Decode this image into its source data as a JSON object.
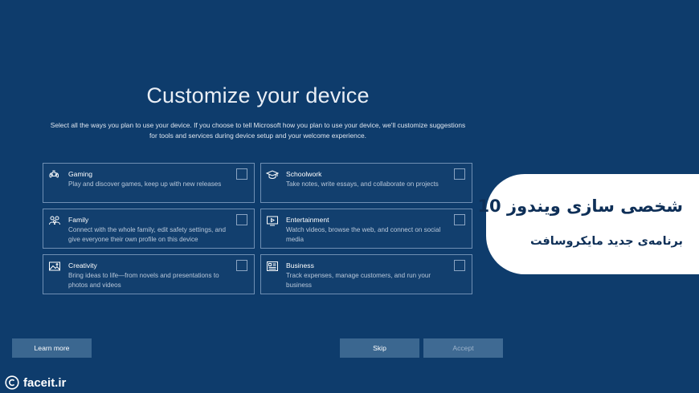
{
  "page": {
    "title": "Customize your device",
    "description": "Select all the ways you plan to use your device. If you choose to tell Microsoft how you plan to use your device, we'll customize suggestions for tools and services during device setup and your welcome experience."
  },
  "options": [
    {
      "name": "Gaming",
      "desc": "Play and discover games, keep up with new releases",
      "icon": "gamepad-icon",
      "checked": false
    },
    {
      "name": "Schoolwork",
      "desc": "Take notes, write essays, and collaborate on projects",
      "icon": "graduation-cap-icon",
      "checked": false
    },
    {
      "name": "Family",
      "desc": "Connect with the whole family, edit safety settings, and give everyone their own profile on this device",
      "icon": "family-icon",
      "checked": false
    },
    {
      "name": "Entertainment",
      "desc": "Watch videos, browse the web, and connect on social media",
      "icon": "entertainment-icon",
      "checked": false
    },
    {
      "name": "Creativity",
      "desc": "Bring ideas to life—from novels and presentations to photos and videos",
      "icon": "picture-icon",
      "checked": false
    },
    {
      "name": "Business",
      "desc": "Track expenses, manage customers, and run your business",
      "icon": "business-icon",
      "checked": false
    }
  ],
  "buttons": {
    "learn_more": "Learn more",
    "skip": "Skip",
    "accept": "Accept"
  },
  "overlay": {
    "headline": "شخصی سازی ویندوز 10",
    "subline": "برنامه‌ی جدید مایکروسافت"
  },
  "watermark": {
    "text": "faceit.ir",
    "icon": "copyright-icon"
  },
  "colors": {
    "background": "#0e3c6c",
    "card_border": "#6f8fb3",
    "button": "#3b6790",
    "overlay_bg": "#ffffff",
    "overlay_text": "#0e2f57"
  }
}
